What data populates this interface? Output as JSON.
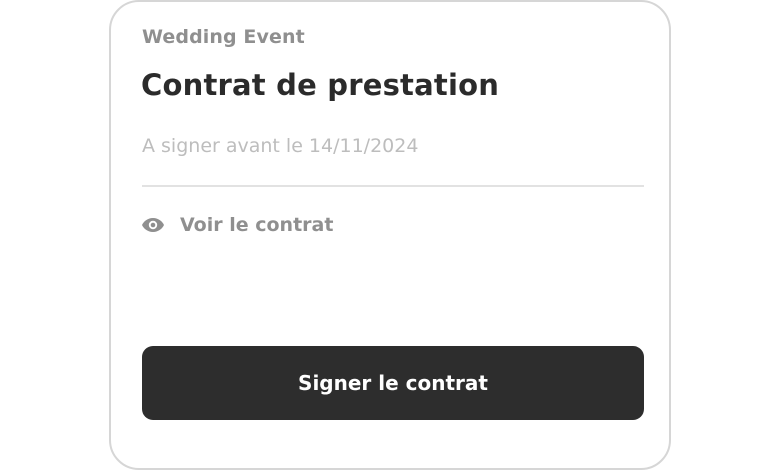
{
  "card": {
    "event_name": "Wedding Event",
    "title": "Contrat de prestation",
    "deadline": "A signer avant le 14/11/2024",
    "view_link": {
      "icon": "eye-icon",
      "label": "Voir le contrat"
    },
    "primary_action": {
      "label": "Signer le contrat"
    }
  },
  "colors": {
    "primary_button_bg": "#2d2d2d",
    "title_text": "#2b2b2b",
    "muted_text": "#8f8f8f",
    "placeholder_text": "#bdbdbd",
    "border": "#d6d6d6"
  }
}
